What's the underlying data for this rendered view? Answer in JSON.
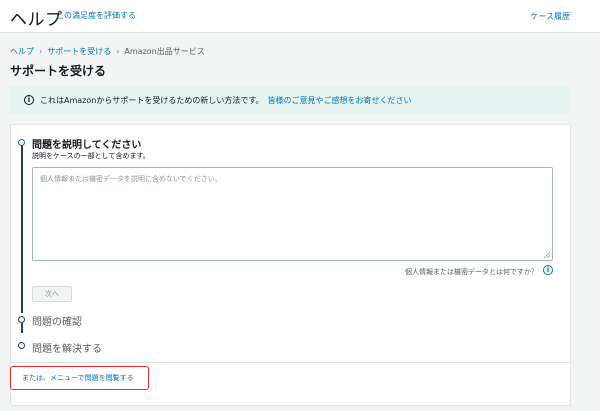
{
  "header": {
    "brand": "ヘルプ",
    "rate_link": "この満足度を評価する",
    "cases_link": "ケース履歴"
  },
  "breadcrumb": {
    "items": [
      "ヘルプ",
      "サポートを受ける",
      "Amazon出品サービス"
    ],
    "separator": "›"
  },
  "page": {
    "title": "サポートを受ける"
  },
  "info_banner": {
    "icon": "info-icon",
    "text": "これはAmazonからサポートを受けるための新しい方法です。",
    "link": "皆様のご意見やご感想をお寄せください"
  },
  "steps": {
    "step1": {
      "title": "問題を説明してください",
      "subtitle": "説明をケースの一部として含めます。",
      "textarea_placeholder": "個人情報または機密データを説明に含めないでください。",
      "help_question": "個人情報または機密データとは何ですか？",
      "help_icon": "i",
      "next_button": "次へ"
    },
    "step2": {
      "title": "問題の確認"
    },
    "step3": {
      "title": "問題を解決する"
    }
  },
  "alt_link": "または、メニューで問題を閲覧する",
  "colors": {
    "accent": "#0073bb",
    "rail": "#2c3e50",
    "banner_bg": "#e6f4f1",
    "highlight": "#e0282e"
  }
}
